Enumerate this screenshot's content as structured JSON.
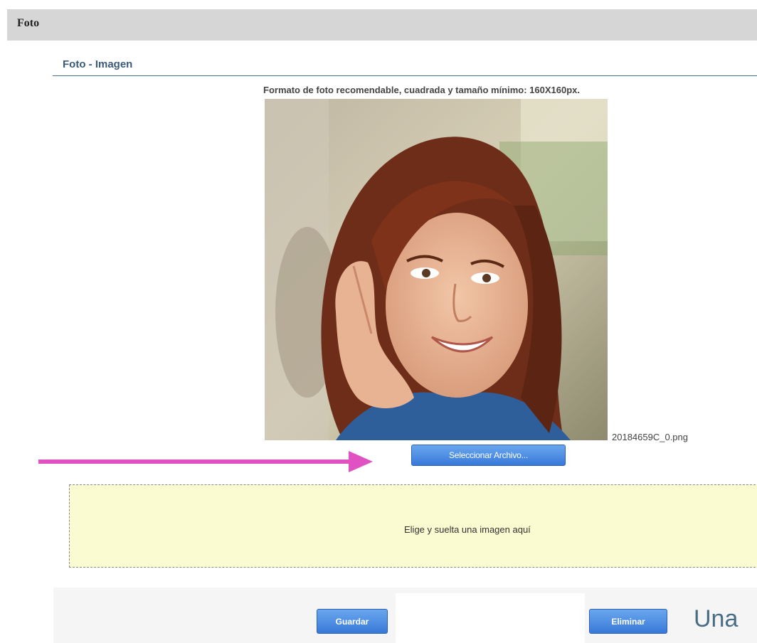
{
  "section": {
    "title": "Foto"
  },
  "photo_panel": {
    "subtitle": "Foto - Imagen",
    "hint": "Formato de foto recomendable, cuadrada y tamaño mínimo: 160X160px.",
    "filename": "20184659C_0.png",
    "select_button": "Seleccionar Archivo..."
  },
  "dropzone": {
    "text": "Elige y suelta una imagen aquí"
  },
  "actions": {
    "save_label": "Guardar",
    "delete_label": "Eliminar"
  },
  "caption": {
    "text": "Una"
  },
  "colors": {
    "accent_blue": "#3879d9",
    "arrow": "#e052c2",
    "dropzone_bg": "#fbfbd1"
  }
}
